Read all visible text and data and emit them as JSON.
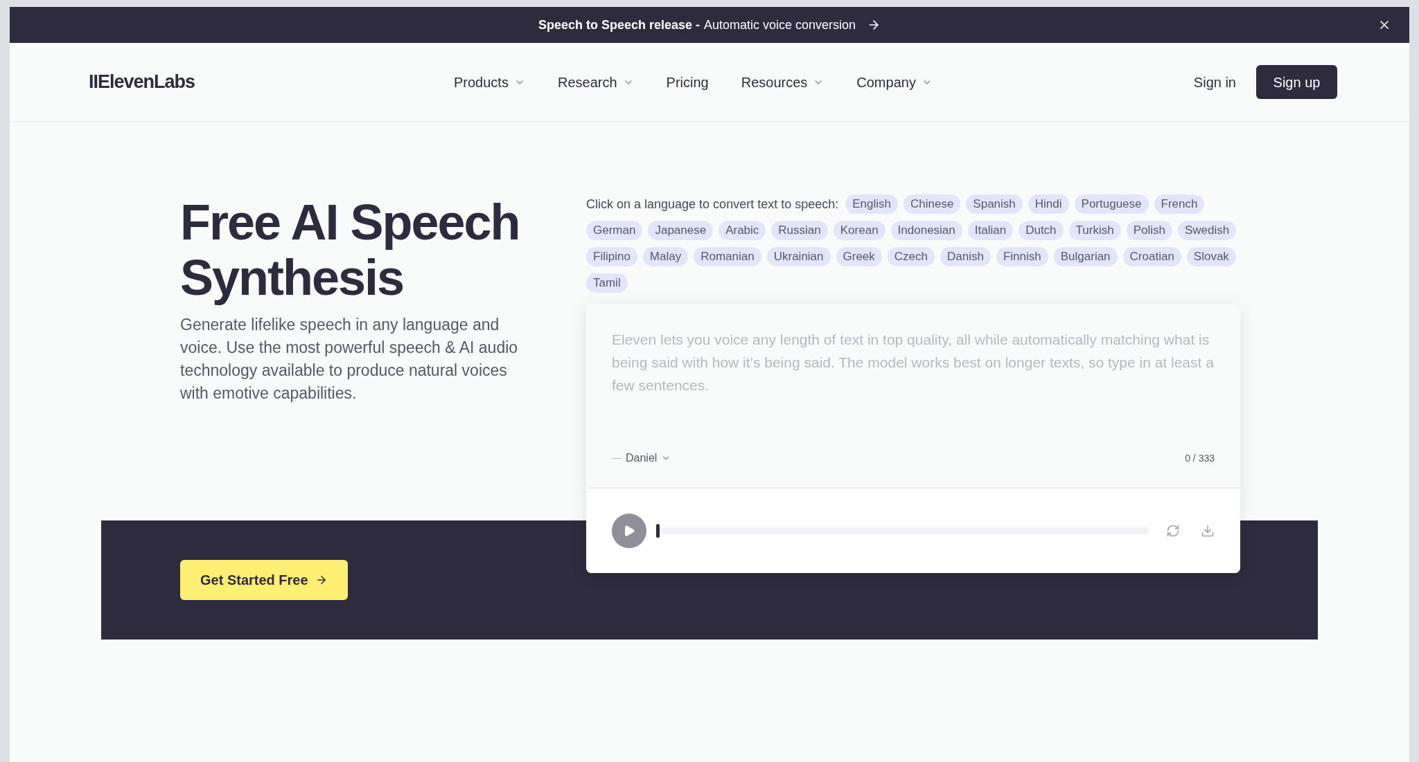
{
  "banner": {
    "bold": "Speech to Speech release -",
    "text": "Automatic voice conversion"
  },
  "nav": {
    "logo": "IIElevenLabs",
    "items": [
      {
        "label": "Products",
        "dropdown": true
      },
      {
        "label": "Research",
        "dropdown": true
      },
      {
        "label": "Pricing",
        "dropdown": false
      },
      {
        "label": "Resources",
        "dropdown": true
      },
      {
        "label": "Company",
        "dropdown": true
      }
    ],
    "sign_in": "Sign in",
    "sign_up": "Sign up"
  },
  "hero": {
    "title_lines": [
      "Free AI Speech",
      "Synthesis"
    ],
    "description": "Generate lifelike speech in any language and voice. Use the most powerful speech & AI audio technology available to produce natural voices with emotive capabilities.",
    "cta": "Get Started Free"
  },
  "languages": {
    "prompt": "Click on a language to convert text to speech:",
    "items": [
      "English",
      "Chinese",
      "Spanish",
      "Hindi",
      "Portuguese",
      "French",
      "German",
      "Japanese",
      "Arabic",
      "Russian",
      "Korean",
      "Indonesian",
      "Italian",
      "Dutch",
      "Turkish",
      "Polish",
      "Swedish",
      "Filipino",
      "Malay",
      "Romanian",
      "Ukrainian",
      "Greek",
      "Czech",
      "Danish",
      "Finnish",
      "Bulgarian",
      "Croatian",
      "Slovak",
      "Tamil"
    ]
  },
  "editor": {
    "placeholder": "Eleven lets you voice any length of text in top quality, all while automatically matching what is being said with how it’s being said. The model works best on longer texts, so type in at least a few sentences.",
    "voice": "Daniel",
    "counter": "0 / 333"
  },
  "player": {
    "level": 0
  }
}
